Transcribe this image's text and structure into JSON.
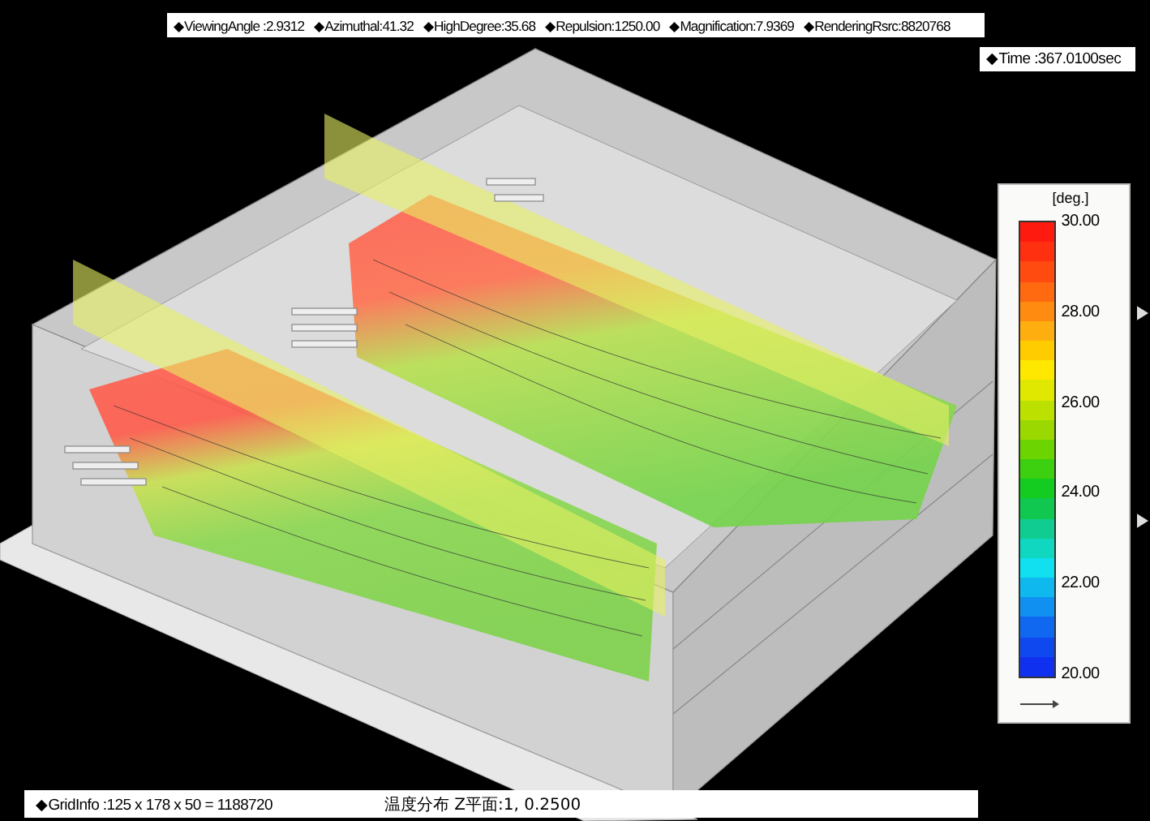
{
  "info_bar": [
    "◆ViewingAngle :2.9312",
    "◆Azimuthal:41.32",
    "◆HighDegree:35.68",
    "◆Repulsion:1250.00",
    "◆Magnification:7.9369",
    "◆RenderingRsrc:8820768"
  ],
  "time": "◆Time :367.0100sec",
  "legend": {
    "unit": "[deg.]",
    "ticks": [
      "30.00",
      "28.00",
      "26.00",
      "24.00",
      "22.00",
      "20.00"
    ]
  },
  "status_bar": {
    "grid_info": "◆GridInfo :125 x 178 x 50 = 1188720",
    "plane_info": "温度分布 Z平面:1, 0.2500"
  }
}
